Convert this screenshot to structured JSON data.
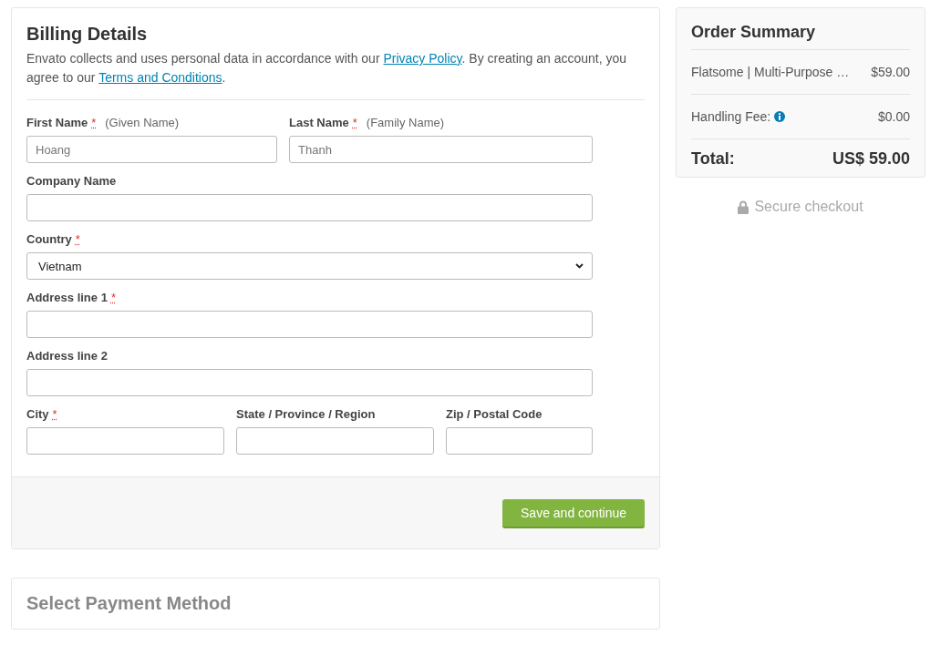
{
  "billing": {
    "title": "Billing Details",
    "notice": [
      {
        "kind": "text",
        "text": "Envato collects and uses personal data in accordance with our "
      },
      {
        "kind": "link",
        "text": "Privacy Policy"
      },
      {
        "kind": "text",
        "text": ". By creating an account, you agree to our "
      },
      {
        "kind": "link",
        "text": "Terms and Conditions"
      },
      {
        "kind": "text",
        "text": "."
      }
    ],
    "field_rows": [
      [
        {
          "kind": "input",
          "label": "First Name",
          "required_mark": "*",
          "hint": "(Given Name)",
          "placeholder": "Hoang"
        },
        {
          "kind": "input",
          "label": "Last Name",
          "required_mark": "*",
          "hint": "(Family Name)",
          "placeholder": "Thanh"
        }
      ],
      [
        {
          "kind": "input",
          "label": "Company Name"
        }
      ],
      [
        {
          "kind": "select",
          "label": "Country",
          "required_mark": "*",
          "value": "Vietnam"
        }
      ],
      [
        {
          "kind": "input",
          "label": "Address line 1",
          "required_mark": "*"
        }
      ],
      [
        {
          "kind": "input",
          "label": "Address line 2"
        }
      ],
      [
        {
          "kind": "input",
          "label": "City",
          "required_mark": "*"
        },
        {
          "kind": "input",
          "label": "State / Province / Region"
        },
        {
          "kind": "input",
          "label": "Zip / Postal Code"
        }
      ]
    ],
    "submit_button": "Save and continue"
  },
  "payment": {
    "title": "Select Payment Method"
  },
  "order_summary": {
    "title": "Order Summary",
    "lines": [
      {
        "kind": "item",
        "label": "Flatsome | Multi-Purpose …",
        "amount": "$59.00"
      },
      {
        "kind": "fee",
        "label": "Handling Fee:",
        "amount": "$0.00"
      }
    ],
    "total": {
      "label": "Total:",
      "amount": "US$ 59.00"
    }
  },
  "secure_note": "Secure checkout"
}
